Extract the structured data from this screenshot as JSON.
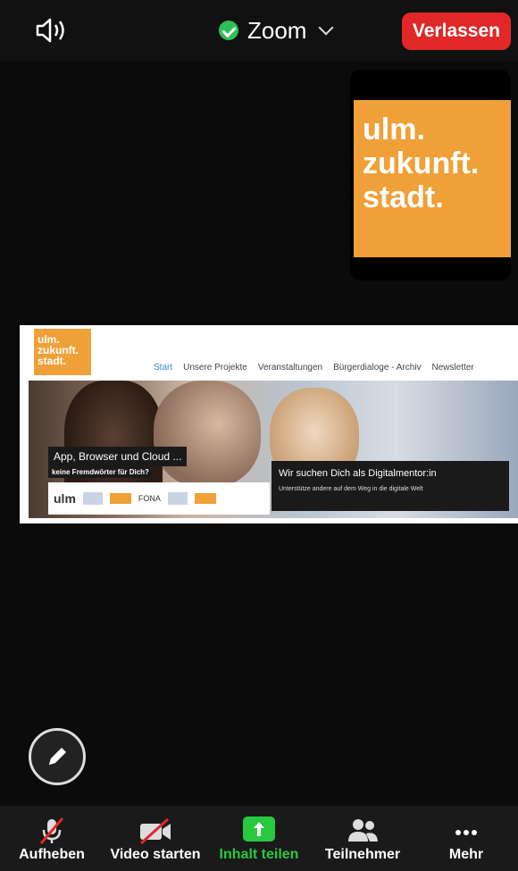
{
  "topbar": {
    "meeting_title": "Zoom",
    "leave_label": "Verlassen"
  },
  "selfview": {
    "logo_lines": [
      "ulm.",
      "zukunft.",
      "stadt."
    ]
  },
  "shared_content": {
    "site_logo_lines": [
      "ulm.",
      "zukunft.",
      "stadt."
    ],
    "nav": [
      "Start",
      "Unsere Projekte",
      "Veranstaltungen",
      "Bürgerdialoge - Archiv",
      "Newsletter"
    ],
    "caption1_title": "App, Browser und Cloud ...",
    "caption1_sub": "keine Fremdwörter für Dich?",
    "sponsor_ulm": "ulm",
    "sponsor_fona": "FONA",
    "caption2_title": "Wir suchen Dich als Digitalmentor:in",
    "caption2_sub": "Unterstütze andere auf dem Weg in die digitale Welt"
  },
  "toolbar": {
    "mute_label": "Aufheben",
    "video_label": "Video starten",
    "share_label": "Inhalt teilen",
    "participants_label": "Teilnehmer",
    "more_label": "Mehr"
  },
  "colors": {
    "leave": "#e02828",
    "share_green": "#28c840",
    "logo_orange": "#f0a038",
    "shield_green": "#2fbf57"
  }
}
